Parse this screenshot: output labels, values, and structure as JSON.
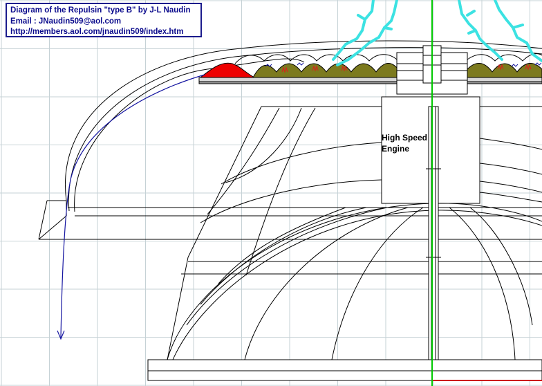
{
  "header": {
    "title": "Diagram of the Repulsin \"type B\" by J-L Naudin",
    "email": "Email : JNaudin509@aol.com",
    "url": "http://members.aol.com/jnaudin509/index.htm"
  },
  "labels": {
    "engine_line1": "High Speed",
    "engine_line2": "Engine"
  },
  "colors": {
    "background": "#ffffff",
    "grid": "#c6d2d6",
    "line": "#000000",
    "title_text": "#0a0a8c",
    "airflow": "#1414a0",
    "axis": "#00c800",
    "red_wave": "#ee0000",
    "olive_wave": "#7c7a1e",
    "discharge": "#3ce2e2",
    "base_red": "#cc0000"
  },
  "icons": {
    "discharge": "lightning-discharge-icon",
    "airflow": "airflow-arrow-icon"
  }
}
